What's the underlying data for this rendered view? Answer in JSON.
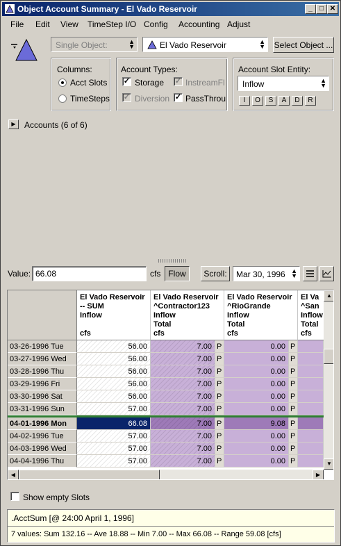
{
  "window": {
    "title": "Object Account Summary - El Vado Reservoir"
  },
  "menu": [
    "File",
    "Edit",
    "View",
    "TimeStep I/O",
    "Config",
    "Accounting",
    "Adjust"
  ],
  "top": {
    "single_object": "Single Object:",
    "object_name": "El Vado Reservoir",
    "select_object": "Select Object ..."
  },
  "columns_group": {
    "title": "Columns:",
    "acct_slots": "Acct Slots",
    "timesteps": "TimeSteps"
  },
  "account_types": {
    "title": "Account Types:",
    "storage": "Storage",
    "instream": "InstreamFl",
    "diversion": "Diversion",
    "passthrough": "PassThrou"
  },
  "slot_entity": {
    "title": "Account Slot Entity:",
    "value": "Inflow",
    "buttons": [
      "I",
      "O",
      "S",
      "A",
      "D",
      "R"
    ]
  },
  "accounts": {
    "label": "Accounts (6 of 6)"
  },
  "value_bar": {
    "label": "Value:",
    "value": "66.08",
    "units": "cfs",
    "flow": "Flow",
    "scroll": "Scroll:",
    "date": "Mar 30, 1996"
  },
  "table": {
    "columns": [
      {
        "l1": "El Vado Reservoir",
        "l2": "-- SUM",
        "l3": "Inflow",
        "l4": "",
        "l5": "cfs"
      },
      {
        "l1": "El Vado Reservoir",
        "l2": "^Contractor123",
        "l3": "Inflow",
        "l4": "Total",
        "l5": "cfs"
      },
      {
        "l1": "El Vado Reservoir",
        "l2": "^RioGrande",
        "l3": "Inflow",
        "l4": "Total",
        "l5": "cfs"
      },
      {
        "l1": "El Va",
        "l2": "^San",
        "l3": "Inflow",
        "l4": "Total",
        "l5": "cfs"
      }
    ],
    "rows": [
      {
        "date": "03-26-1996 Tue",
        "sum": "56.00",
        "c2": "7.00",
        "f2": "P",
        "c3": "0.00",
        "f3": "P"
      },
      {
        "date": "03-27-1996 Wed",
        "sum": "56.00",
        "c2": "7.00",
        "f2": "P",
        "c3": "0.00",
        "f3": "P"
      },
      {
        "date": "03-28-1996 Thu",
        "sum": "56.00",
        "c2": "7.00",
        "f2": "P",
        "c3": "0.00",
        "f3": "P"
      },
      {
        "date": "03-29-1996 Fri",
        "sum": "56.00",
        "c2": "7.00",
        "f2": "P",
        "c3": "0.00",
        "f3": "P"
      },
      {
        "date": "03-30-1996 Sat",
        "sum": "56.00",
        "c2": "7.00",
        "f2": "P",
        "c3": "0.00",
        "f3": "P"
      },
      {
        "date": "03-31-1996 Sun",
        "sum": "57.00",
        "c2": "7.00",
        "f2": "P",
        "c3": "0.00",
        "f3": "P"
      },
      {
        "date": "04-01-1996 Mon",
        "sum": "66.08",
        "c2": "7.00",
        "f2": "P",
        "c3": "9.08",
        "f3": "P"
      },
      {
        "date": "04-02-1996 Tue",
        "sum": "57.00",
        "c2": "7.00",
        "f2": "P",
        "c3": "0.00",
        "f3": "P"
      },
      {
        "date": "04-03-1996 Wed",
        "sum": "57.00",
        "c2": "7.00",
        "f2": "P",
        "c3": "0.00",
        "f3": "P"
      },
      {
        "date": "04-04-1996 Thu",
        "sum": "57.00",
        "c2": "7.00",
        "f2": "P",
        "c3": "0.00",
        "f3": "P"
      }
    ]
  },
  "show_empty": "Show empty Slots",
  "status": {
    "line1": ".AcctSum [@ 24:00 April 1, 1996]",
    "line2": "7 values:  Sum 132.16 -- Ave 18.88 -- Min 7.00 -- Max 66.08 -- Range 59.08 [cfs]"
  }
}
